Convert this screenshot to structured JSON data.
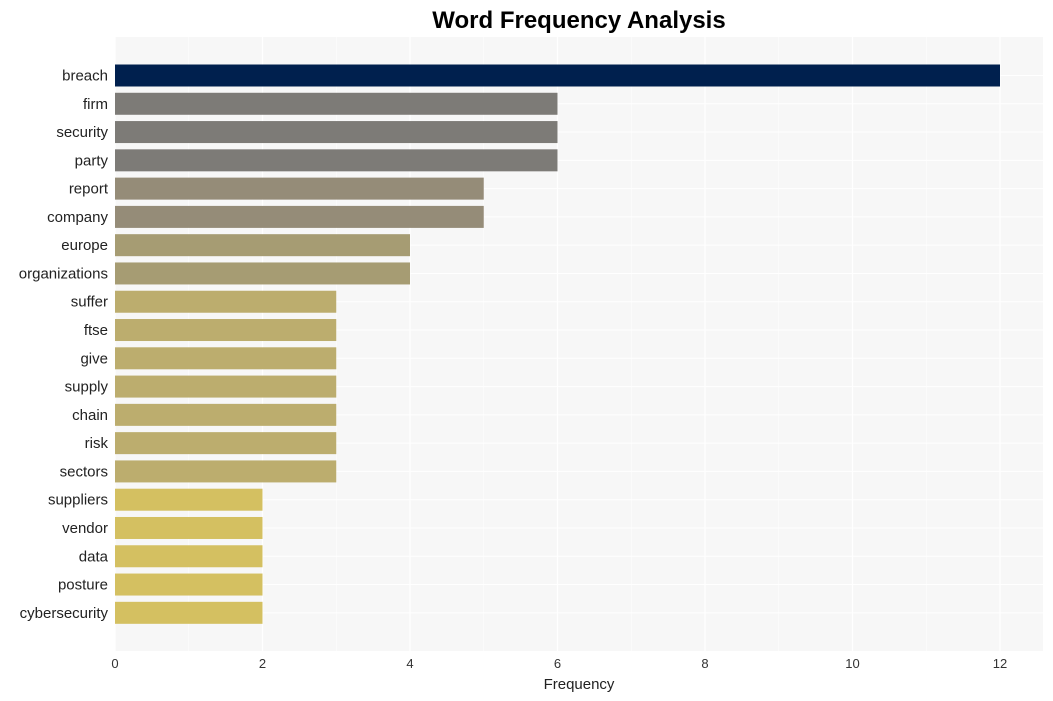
{
  "chart_data": {
    "type": "bar",
    "orientation": "horizontal",
    "title": "Word Frequency Analysis",
    "xlabel": "Frequency",
    "ylabel": "",
    "xlim": [
      0,
      12.3
    ],
    "xticks": [
      0,
      2,
      4,
      6,
      8,
      10,
      12
    ],
    "grid": true,
    "categories": [
      "breach",
      "firm",
      "security",
      "party",
      "report",
      "company",
      "europe",
      "organizations",
      "suffer",
      "ftse",
      "give",
      "supply",
      "chain",
      "risk",
      "sectors",
      "suppliers",
      "vendor",
      "data",
      "posture",
      "cybersecurity"
    ],
    "values": [
      12,
      6,
      6,
      6,
      5,
      5,
      4,
      4,
      3,
      3,
      3,
      3,
      3,
      3,
      3,
      2,
      2,
      2,
      2,
      2
    ],
    "colors": {
      "12": "#00204e",
      "6": "#7d7b77",
      "5": "#958c78",
      "4": "#a69c73",
      "3": "#bcad6e",
      "2": "#d4c061"
    },
    "background": "#f7f7f7",
    "gridline_color": "#ffffff"
  }
}
